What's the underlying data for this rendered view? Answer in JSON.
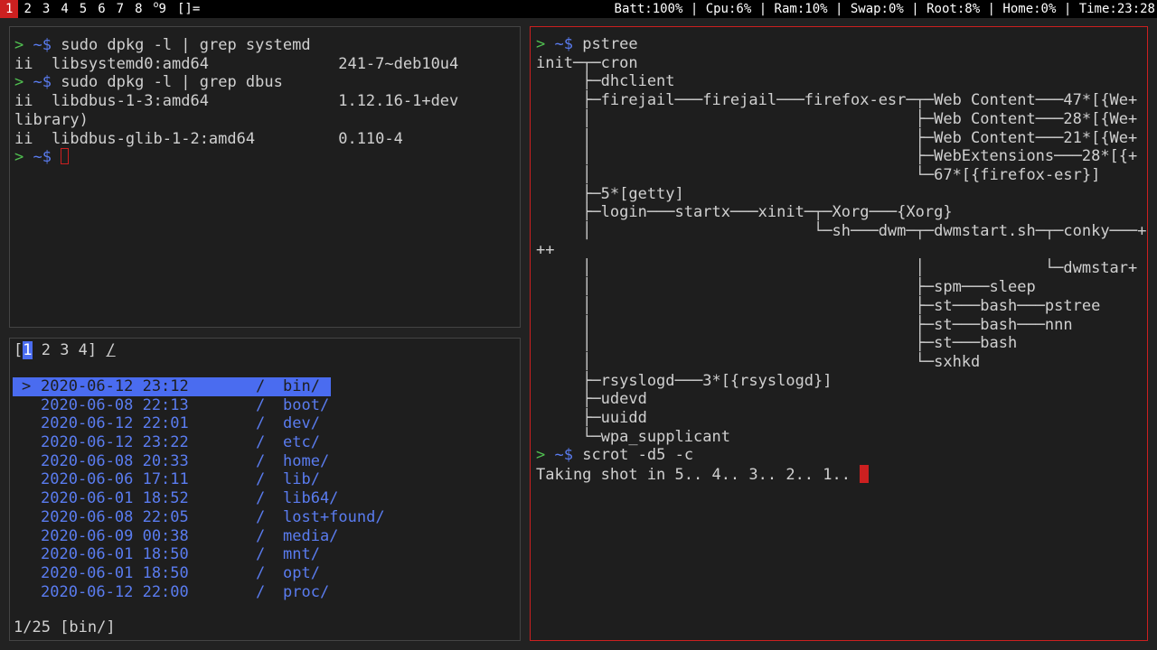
{
  "bar": {
    "tags": [
      {
        "label": "1",
        "active": true
      },
      {
        "label": "2"
      },
      {
        "label": "3"
      },
      {
        "label": "4"
      },
      {
        "label": "5"
      },
      {
        "label": "6"
      },
      {
        "label": "7"
      },
      {
        "label": "8"
      },
      {
        "label": "9",
        "sup": "o"
      }
    ],
    "layout": "[]=",
    "status": "Batt:100% | Cpu:6% | Ram:10% | Swap:0% | Root:8% | Home:0% | Time:23:28"
  },
  "term1": {
    "lines": [
      {
        "prompt": true,
        "cmd": "sudo dpkg -l | grep systemd"
      },
      {
        "text": "ii  libsystemd0:amd64              241-7~deb10u4"
      },
      {
        "prompt": true,
        "cmd": "sudo dpkg -l | grep dbus"
      },
      {
        "text": "ii  libdbus-1-3:amd64              1.12.16-1+dev"
      },
      {
        "text": "library)"
      },
      {
        "text": "ii  libdbus-glib-1-2:amd64         0.110-4"
      },
      {
        "prompt": true,
        "cmd": "",
        "cursor": true
      }
    ],
    "prompt_arrow": ">",
    "prompt_dir": "~$"
  },
  "nnn": {
    "tabs_open": "[",
    "active_tab": "1",
    "tabs_rest": " 2 3 4]",
    "path": "/",
    "entries": [
      {
        "date": "2020-06-12 23:12",
        "name": "bin/",
        "selected": true
      },
      {
        "date": "2020-06-08 22:13",
        "name": "boot/"
      },
      {
        "date": "2020-06-12 22:01",
        "name": "dev/"
      },
      {
        "date": "2020-06-12 23:22",
        "name": "etc/"
      },
      {
        "date": "2020-06-08 20:33",
        "name": "home/"
      },
      {
        "date": "2020-06-06 17:11",
        "name": "lib/"
      },
      {
        "date": "2020-06-01 18:52",
        "name": "lib64/"
      },
      {
        "date": "2020-06-08 22:05",
        "name": "lost+found/"
      },
      {
        "date": "2020-06-09 00:38",
        "name": "media/"
      },
      {
        "date": "2020-06-01 18:50",
        "name": "mnt/"
      },
      {
        "date": "2020-06-01 18:50",
        "name": "opt/"
      },
      {
        "date": "2020-06-12 22:00",
        "name": "proc/"
      }
    ],
    "slash": "/",
    "marker": ">",
    "status": "1/25 [bin/]"
  },
  "term3": {
    "lines": [
      {
        "prompt": true,
        "cmd": "pstree"
      },
      {
        "text": "init─┬─cron"
      },
      {
        "text": "     ├─dhclient"
      },
      {
        "text": "     ├─firejail───firejail───firefox-esr─┬─Web Content───47*[{We+"
      },
      {
        "text": "     │                                   ├─Web Content───28*[{We+"
      },
      {
        "text": "     │                                   ├─Web Content───21*[{We+"
      },
      {
        "text": "     │                                   ├─WebExtensions───28*[{+"
      },
      {
        "text": "     │                                   └─67*[{firefox-esr}]"
      },
      {
        "text": "     ├─5*[getty]"
      },
      {
        "text": "     ├─login───startx───xinit─┬─Xorg───{Xorg}"
      },
      {
        "text": "     │                        └─sh───dwm─┬─dwmstart.sh─┬─conky───+"
      },
      {
        "text": "++"
      },
      {
        "text": "     │                                   │             └─dwmstar+"
      },
      {
        "text": "     │                                   ├─spm───sleep"
      },
      {
        "text": "     │                                   ├─st───bash───pstree"
      },
      {
        "text": "     │                                   ├─st───bash───nnn"
      },
      {
        "text": "     │                                   ├─st───bash"
      },
      {
        "text": "     │                                   └─sxhkd"
      },
      {
        "text": "     ├─rsyslogd───3*[{rsyslogd}]"
      },
      {
        "text": "     ├─udevd"
      },
      {
        "text": "     ├─uuidd"
      },
      {
        "text": "     └─wpa_supplicant"
      },
      {
        "prompt": true,
        "cmd": "scrot -d5 -c"
      },
      {
        "text": "Taking shot in 5.. 4.. 3.. 2.. 1.. ",
        "cursor": true
      }
    ],
    "prompt_arrow": ">",
    "prompt_dir": "~$"
  },
  "colors": {
    "accent_red": "#cc2020",
    "prompt_green": "#50c050",
    "dir_blue": "#5a7cf0"
  }
}
